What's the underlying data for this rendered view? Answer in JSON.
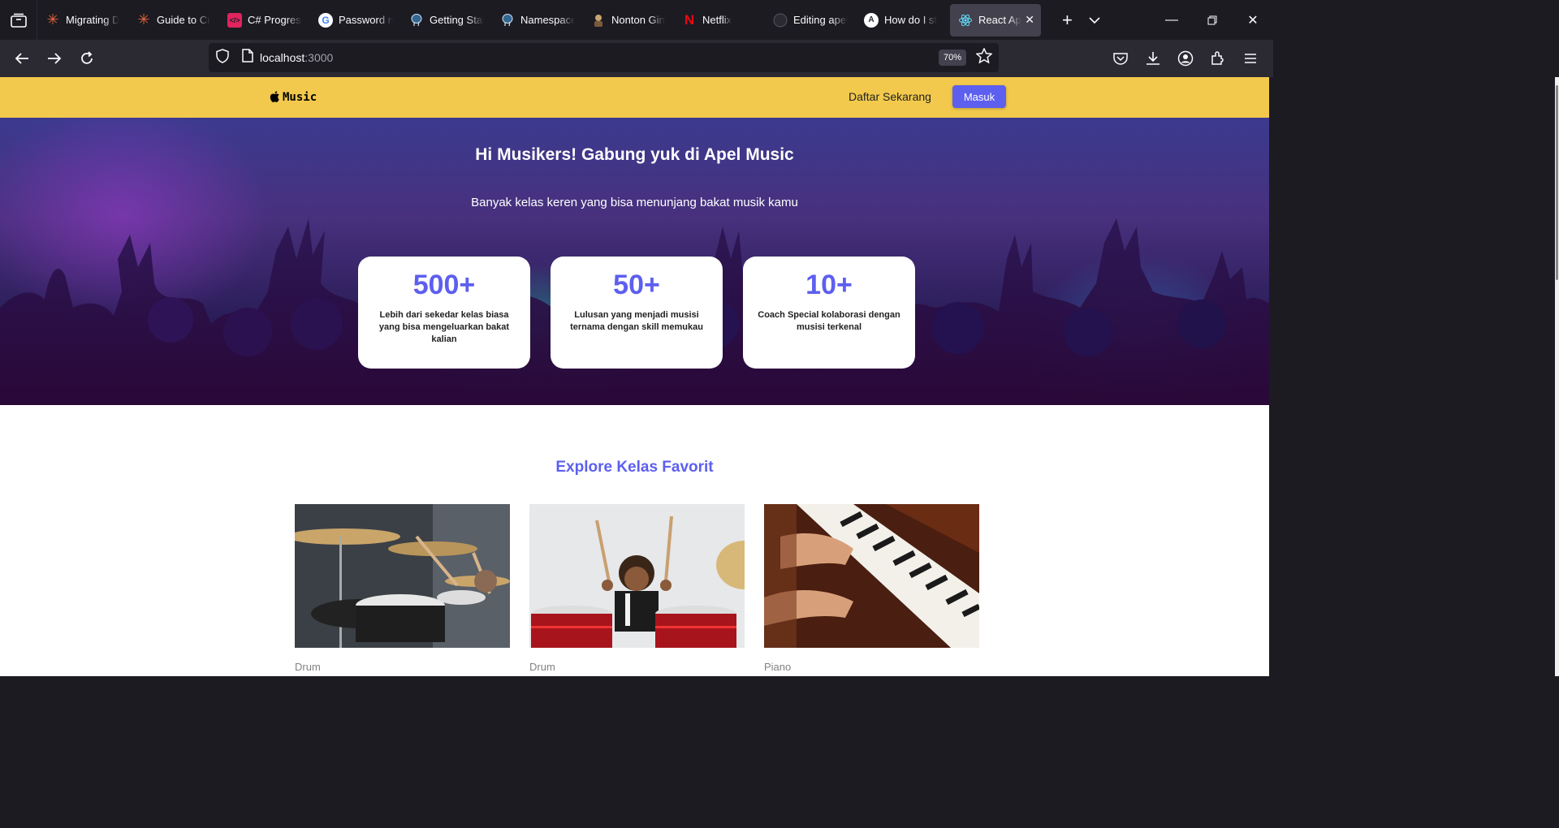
{
  "browser": {
    "tabs": [
      {
        "title": "Migrating D",
        "icon": "sparkle-icon",
        "color": "#e8663d"
      },
      {
        "title": "Guide to Cr",
        "icon": "sparkle-icon",
        "color": "#e8663d"
      },
      {
        "title": "C# Progress",
        "icon": "code-icon",
        "color": "#e0245e"
      },
      {
        "title": "Password re",
        "icon": "google-icon",
        "color": "#ffffff"
      },
      {
        "title": "Getting Star",
        "icon": "postgres-icon",
        "color": "#6fa8dc"
      },
      {
        "title": "Namespace",
        "icon": "postgres-icon",
        "color": "#6fa8dc"
      },
      {
        "title": "Nonton Gin",
        "icon": "character-icon",
        "color": "#c8a46e"
      },
      {
        "title": "Netflix",
        "icon": "netflix-icon",
        "color": "#e50914"
      },
      {
        "title": "Editing apel",
        "icon": "github-icon",
        "color": "#2b2a33"
      },
      {
        "title": "How do I st",
        "icon": "angular-icon",
        "color": "#5c5cd6"
      },
      {
        "title": "React Ap",
        "icon": "react-icon",
        "color": "#61dafb",
        "active": true
      }
    ],
    "url_host": "localhost",
    "url_port": ":3000",
    "zoom": "70%"
  },
  "site": {
    "logo_text": "Music",
    "nav_register": "Daftar Sekarang",
    "nav_login": "Masuk"
  },
  "hero": {
    "title": "Hi Musikers! Gabung yuk di Apel Music",
    "subtitle": "Banyak kelas keren yang bisa menunjang bakat musik kamu",
    "stats": [
      {
        "value": "500+",
        "desc": "Lebih dari sekedar kelas biasa yang bisa mengeluarkan bakat kalian"
      },
      {
        "value": "50+",
        "desc": "Lulusan yang menjadi musisi ternama dengan skill memukau"
      },
      {
        "value": "10+",
        "desc": "Coach Special kolaborasi dengan musisi terkenal"
      }
    ]
  },
  "explore": {
    "title": "Explore Kelas Favorit",
    "classes": [
      {
        "category": "Drum"
      },
      {
        "category": "Drum"
      },
      {
        "category": "Piano"
      }
    ]
  },
  "colors": {
    "header_bg": "#f2c94c",
    "accent": "#5d5fef"
  }
}
